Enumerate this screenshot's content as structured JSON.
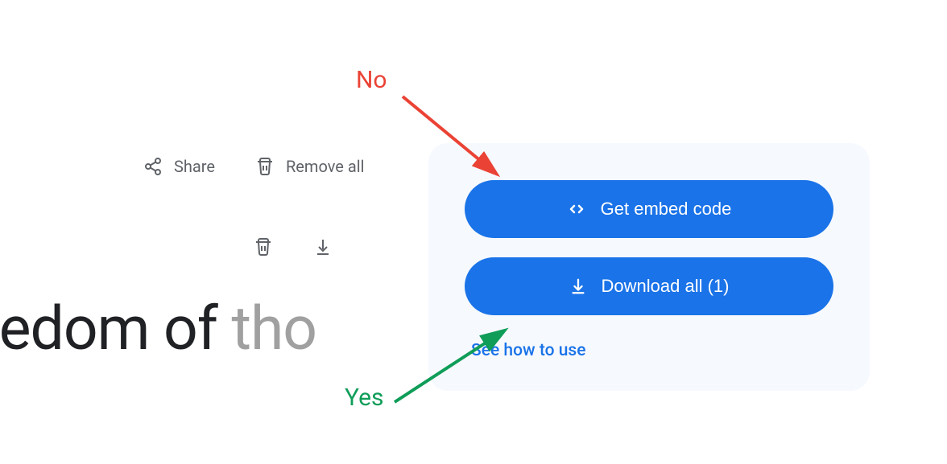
{
  "toolbar": {
    "share_label": "Share",
    "remove_all_label": "Remove all"
  },
  "display": {
    "main_text": "eedom of ",
    "fade_text": "tho"
  },
  "panel": {
    "embed_label": "Get embed code",
    "download_label": "Download all (1)",
    "help_link": "See how to use"
  },
  "annotations": {
    "no_label": "No",
    "yes_label": "Yes"
  },
  "colors": {
    "primary": "#1a73e8",
    "panel_bg": "#f6f9fe",
    "no_color": "#ea4335",
    "yes_color": "#0f9d58",
    "toolbar_icon": "#5f6368"
  }
}
